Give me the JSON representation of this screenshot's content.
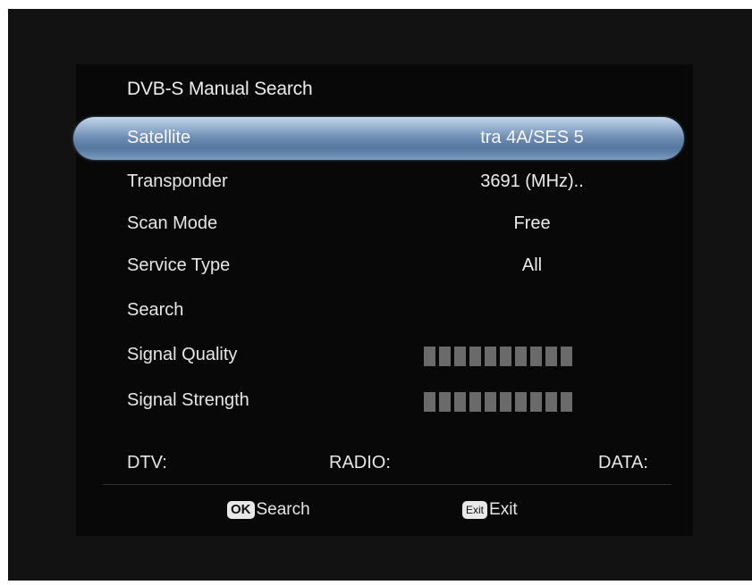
{
  "menu": {
    "title": "DVB-S Manual Search",
    "rows": [
      {
        "label": "Satellite",
        "value": "tra 4A/SES 5",
        "selected": true
      },
      {
        "label": "Transponder",
        "value": "3691 (MHz).."
      },
      {
        "label": "Scan Mode",
        "value": "Free"
      },
      {
        "label": "Service Type",
        "value": "All"
      },
      {
        "label": "Search",
        "value": ""
      },
      {
        "label": "Signal Quality",
        "value": ""
      },
      {
        "label": "Signal Strength",
        "value": ""
      }
    ],
    "counts": {
      "dtv_label": "DTV:",
      "radio_label": "RADIO:",
      "data_label": "DATA:"
    }
  },
  "hints": {
    "ok_key": "OK",
    "ok_text": "Search",
    "exit_key": "Exit",
    "exit_text": "Exit"
  },
  "colors": {
    "highlight": "#6c8bb1",
    "bar": "#6a6a6a",
    "background": "#080808"
  }
}
